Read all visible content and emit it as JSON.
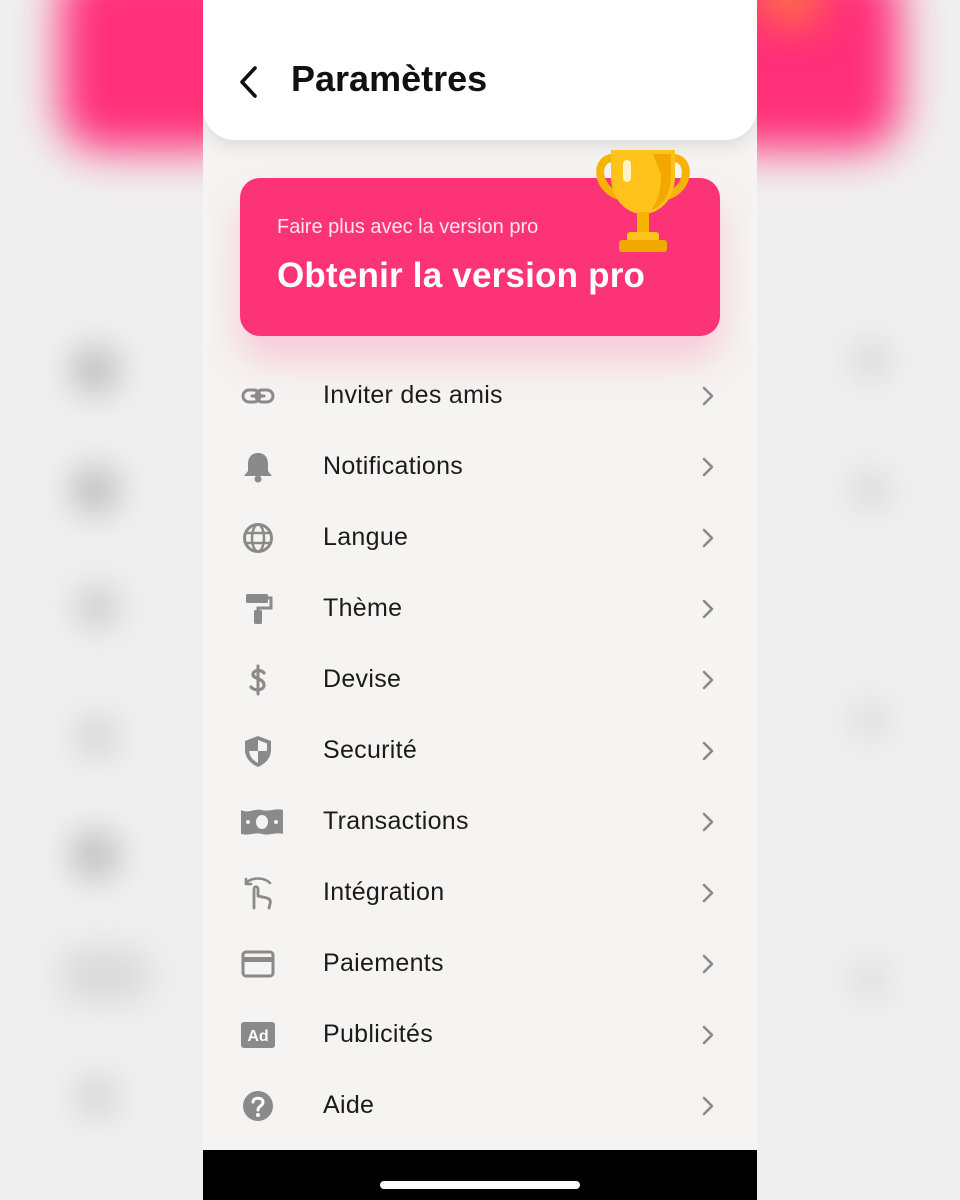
{
  "header": {
    "title": "Paramètres",
    "back_icon": "chevron-left-icon"
  },
  "promo": {
    "subtitle": "Faire plus avec la version pro",
    "title": "Obtenir la version pro",
    "icon": "trophy-icon",
    "color": "#fd3377"
  },
  "settings": {
    "items": [
      {
        "label": "Inviter des amis",
        "icon": "link-icon"
      },
      {
        "label": "Notifications",
        "icon": "bell-icon"
      },
      {
        "label": "Langue",
        "icon": "globe-icon"
      },
      {
        "label": "Thème",
        "icon": "paint-roller-icon"
      },
      {
        "label": "Devise",
        "icon": "dollar-icon"
      },
      {
        "label": "Securité",
        "icon": "shield-icon"
      },
      {
        "label": "Transactions",
        "icon": "banknote-icon"
      },
      {
        "label": "Intégration",
        "icon": "touch-swipe-icon"
      },
      {
        "label": "Paiements",
        "icon": "credit-card-icon"
      },
      {
        "label": "Publicités",
        "icon": "ad-icon",
        "icon_text": "Ad"
      },
      {
        "label": "Aide",
        "icon": "help-icon"
      }
    ]
  },
  "colors": {
    "accent": "#fd3377",
    "icon_gray": "#8a8a8a",
    "background": "#f5f4f3"
  }
}
